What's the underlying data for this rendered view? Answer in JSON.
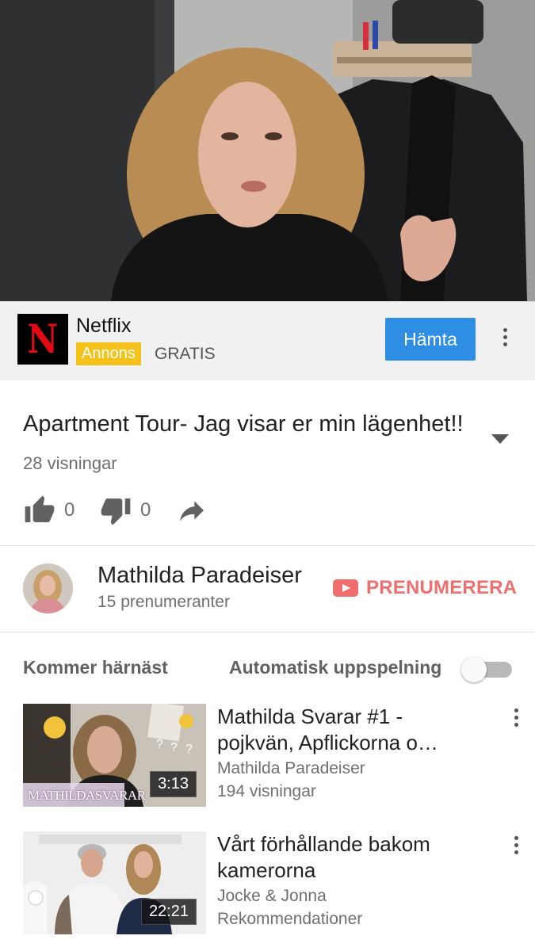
{
  "ad": {
    "logo_letter": "N",
    "name": "Netflix",
    "badge": "Annons",
    "price": "GRATIS",
    "cta": "Hämta"
  },
  "video": {
    "title": "Apartment Tour- Jag visar er min lägenhet!!",
    "views": "28 visningar",
    "likes": "0",
    "dislikes": "0"
  },
  "channel": {
    "name": "Mathilda Paradeiser",
    "subscribers": "15 prenumeranter",
    "subscribe_label": "PRENUMERERA"
  },
  "up_next": {
    "label": "Kommer härnäst",
    "autoplay_label": "Automatisk uppspelning",
    "autoplay_on": false,
    "items": [
      {
        "title": "Mathilda Svarar #1 - pojkvän, Apflickorna o…",
        "channel": "Mathilda Paradeiser",
        "meta": "194 visningar",
        "duration": "3:13",
        "thumb_caption": "MATHILDASVARAR"
      },
      {
        "title": "Vårt förhållande bakom kamerorna",
        "channel": "Jocke & Jonna",
        "meta": "Rekommendationer",
        "duration": "22:21"
      }
    ]
  },
  "colors": {
    "cta_blue": "#2d8ee4",
    "ad_badge_yellow": "#f4c21a",
    "subscribe_red": "#ef6e6e",
    "netflix_red": "#e50914"
  }
}
